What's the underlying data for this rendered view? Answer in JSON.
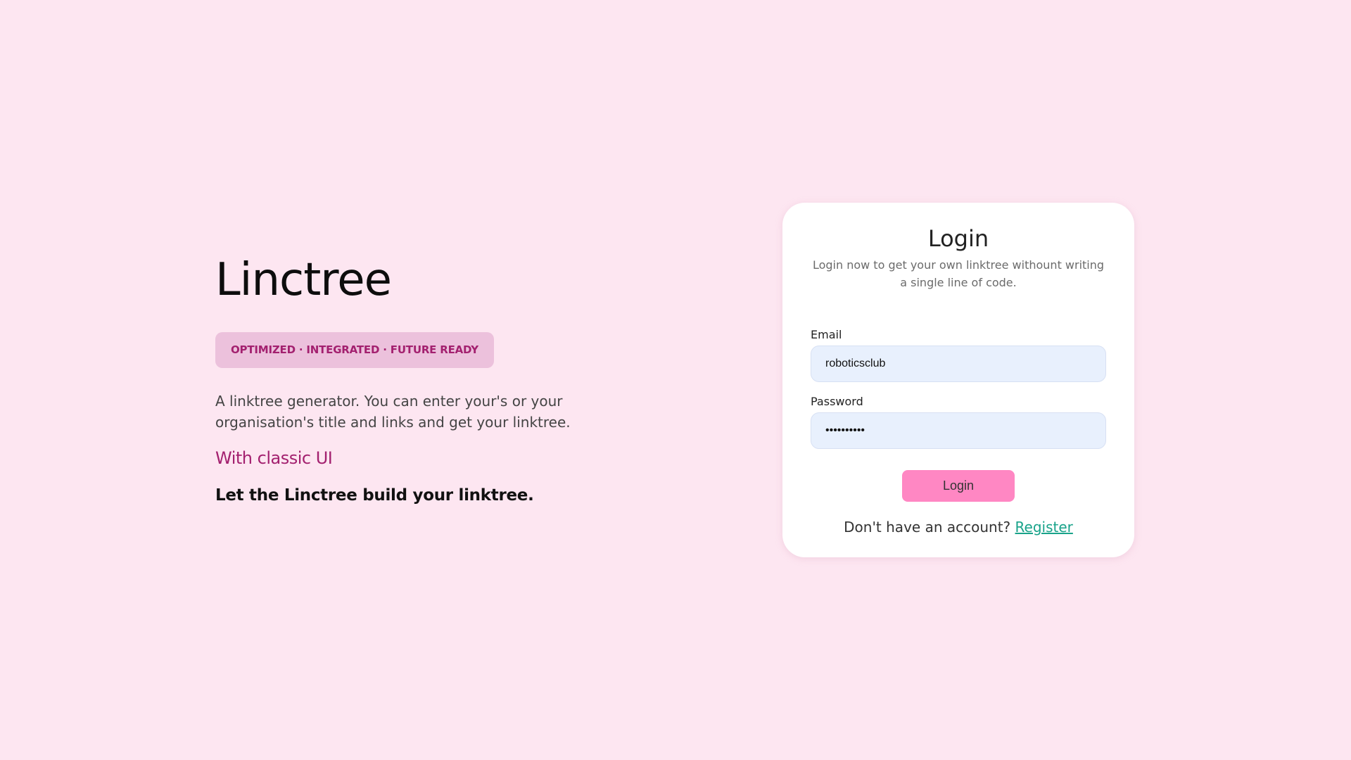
{
  "hero": {
    "title": "Linctree",
    "badge": "OPTIMIZED · INTEGRATED · FUTURE READY",
    "description": "A linktree generator. You can enter your's or your organisation's title and links and get your linktree.",
    "tagline": "With classic UI",
    "cta": "Let the Linctree build your linktree."
  },
  "login": {
    "title": "Login",
    "subtitle": "Login now to get your own linktree withount writing a single line of code.",
    "email_label": "Email",
    "email_value": "roboticsclub",
    "password_label": "Password",
    "password_value": "••••••••••",
    "button_label": "Login",
    "footer_text": "Don't have an account?",
    "register_label": "Register"
  },
  "colors": {
    "background": "#fde6f1",
    "accent": "#a3206f",
    "badge_bg": "#ecc1dc",
    "button": "#ff87c3",
    "input_bg": "#e8f0fd",
    "link": "#19a38a"
  }
}
